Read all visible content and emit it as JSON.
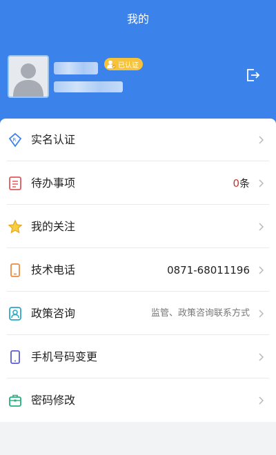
{
  "header": {
    "title": "我的",
    "badge_label": "已认证",
    "accent_color": "#3b82ea"
  },
  "menu": {
    "items": [
      {
        "label": "实名认证",
        "icon": "id-badge-icon"
      },
      {
        "label": "待办事项",
        "icon": "todo-list-icon",
        "count": "0",
        "unit": "条"
      },
      {
        "label": "我的关注",
        "icon": "star-icon"
      },
      {
        "label": "技术电话",
        "icon": "phone-icon",
        "value": "0871-68011196"
      },
      {
        "label": "政策咨询",
        "icon": "contact-card-icon",
        "value": "监管、政策咨询联系方式"
      },
      {
        "label": "手机号码变更",
        "icon": "mobile-icon"
      },
      {
        "label": "密码修改",
        "icon": "briefcase-icon"
      }
    ]
  }
}
